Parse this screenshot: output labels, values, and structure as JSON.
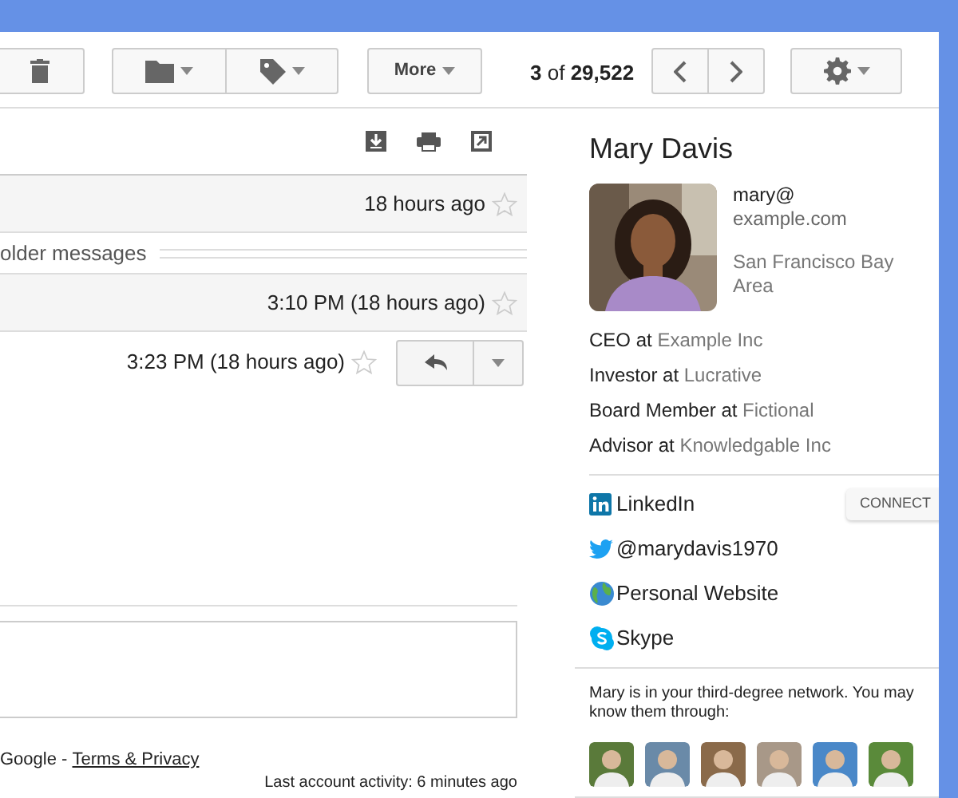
{
  "toolbar": {
    "more_label": "More",
    "pager": {
      "current": "3",
      "of": "of",
      "total": "29,522"
    }
  },
  "thread": {
    "messages": [
      {
        "kind": "collapsed",
        "time": "18 hours ago",
        "starred": false
      },
      {
        "kind": "older",
        "label": "older messages"
      },
      {
        "kind": "collapsed",
        "time": "3:10 PM (18 hours ago)",
        "starred": false
      },
      {
        "kind": "open",
        "time": "3:23 PM (18 hours ago)",
        "starred": false
      }
    ]
  },
  "footer": {
    "prefix": "Google -",
    "link": "Terms & Privacy",
    "activity": "Last account activity: 6 minutes ago"
  },
  "contact": {
    "name": "Mary Davis",
    "email_user": "mary@",
    "email_domain": "example.com",
    "location": "San Francisco Bay Area",
    "roles": [
      {
        "title": "CEO at",
        "org": "Example Inc"
      },
      {
        "title": "Investor at",
        "org": "Lucrative"
      },
      {
        "title": "Board Member at",
        "org": "Fictional"
      },
      {
        "title": "Advisor at",
        "org": "Knowledgable Inc"
      }
    ],
    "links": [
      {
        "kind": "linkedin",
        "label": "LinkedIn",
        "action": "CONNECT"
      },
      {
        "kind": "twitter",
        "label": "@marydavis1970"
      },
      {
        "kind": "web",
        "label": "Personal Website"
      },
      {
        "kind": "skype",
        "label": "Skype"
      }
    ],
    "network_note": "Mary is in your third-degree network. You may know them through:",
    "connections": [
      {
        "color": "#5a7a3a"
      },
      {
        "color": "#6a8aa8"
      },
      {
        "color": "#8a6a4a"
      },
      {
        "color": "#a89888"
      },
      {
        "color": "#4a88c8"
      },
      {
        "color": "#5a8a3a"
      }
    ]
  }
}
